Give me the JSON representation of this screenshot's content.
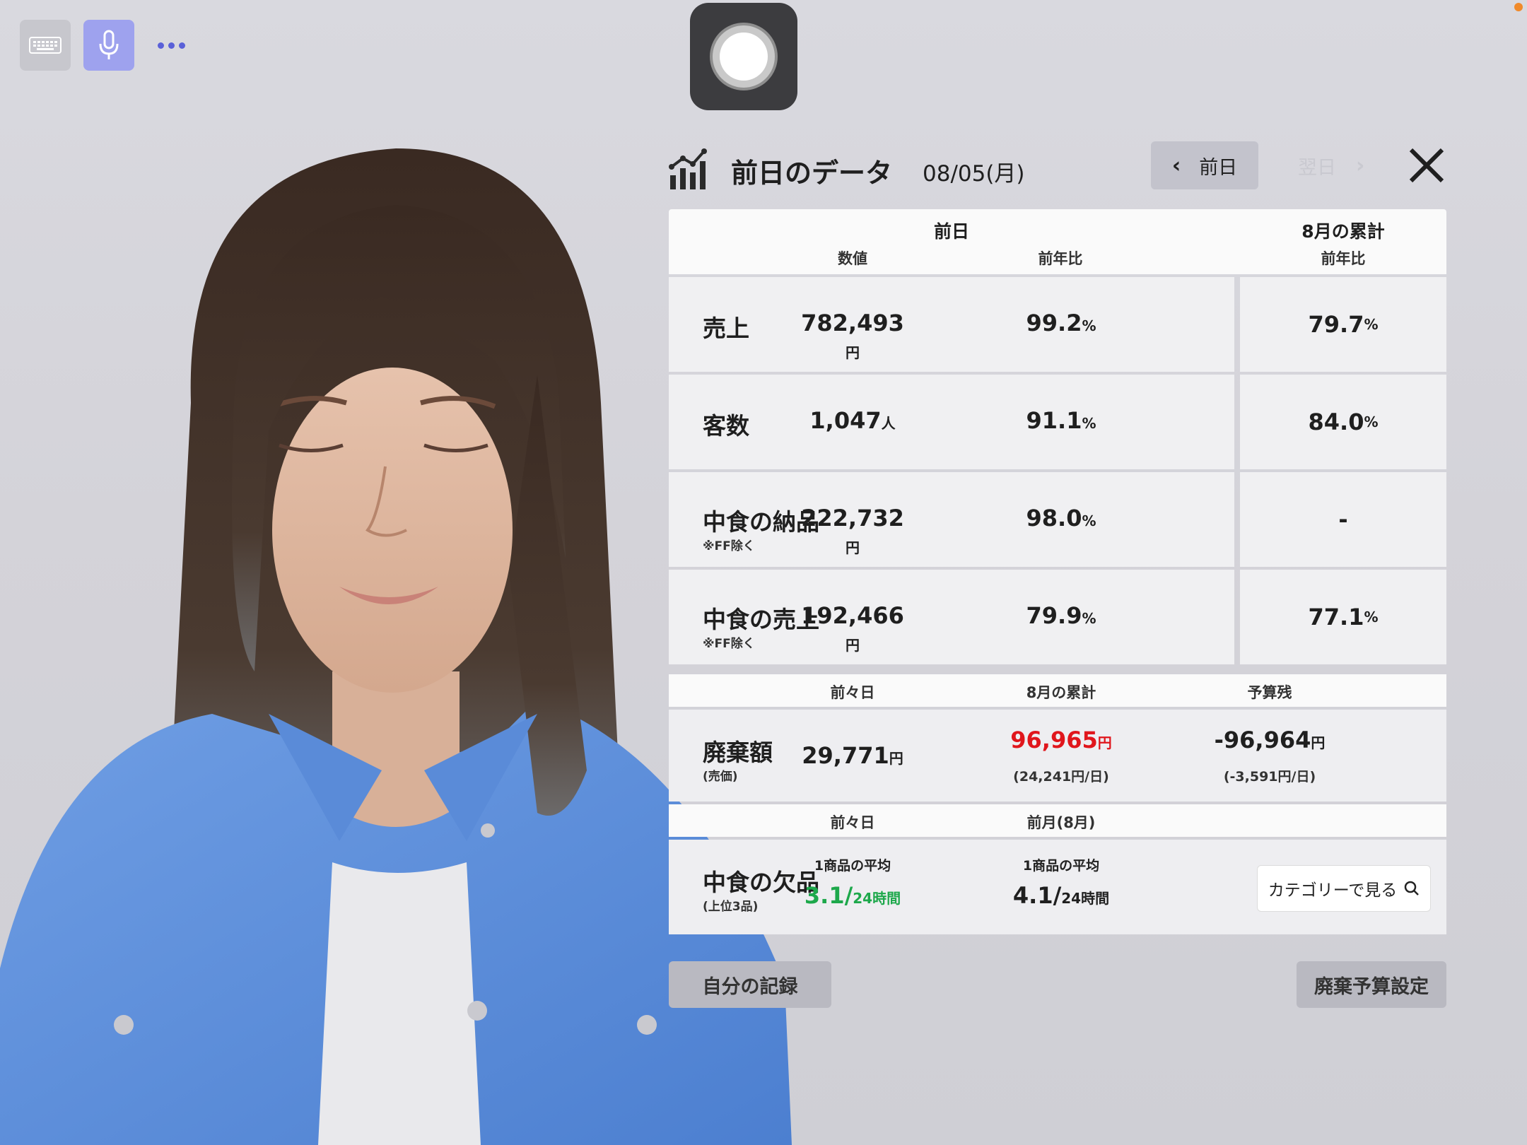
{
  "toolbar": {
    "keyboard_icon": "keyboard-icon",
    "mic_icon": "microphone-icon",
    "more_icon": "more-dots-icon"
  },
  "record_button": {
    "icon": "record-icon"
  },
  "header": {
    "title": "前日のデータ",
    "date": "08/05(月)",
    "prev_label": "前日",
    "next_label": "翌日",
    "close_icon": "close-icon",
    "chart_icon": "chart-icon"
  },
  "table_header": {
    "group_prev": "前日",
    "group_month": "8月の累計",
    "col_value": "数値",
    "col_yoy": "前年比",
    "col_month_yoy": "前年比"
  },
  "rows": [
    {
      "label": "売上",
      "note": "",
      "value": "782,493",
      "unit": "円",
      "yoy": "99.2",
      "month_yoy": "79.7"
    },
    {
      "label": "客数",
      "note": "",
      "value": "1,047",
      "unit": "人",
      "yoy": "91.1",
      "month_yoy": "84.0"
    },
    {
      "label": "中食の納品",
      "note": "※FF除く",
      "value": "222,732",
      "unit": "円",
      "yoy": "98.0",
      "month_yoy": "-"
    },
    {
      "label": "中食の売上",
      "note": "※FF除く",
      "value": "192,466",
      "unit": "円",
      "yoy": "79.9",
      "month_yoy": "77.1"
    }
  ],
  "pct_unit": "%",
  "waste": {
    "hdr_prev2": "前々日",
    "hdr_month": "8月の累計",
    "hdr_budget": "予算残",
    "label": "廃棄額",
    "note": "(売価)",
    "prev2_value": "29,771",
    "month_value": "96,965",
    "month_daily": "(24,241円/日)",
    "budget_value": "-96,964",
    "budget_daily": "(-3,591円/日)",
    "unit": "円"
  },
  "shortage": {
    "hdr_prev2": "前々日",
    "hdr_last_month": "前月(8月)",
    "label": "中食の欠品",
    "note": "(上位3品)",
    "avg_label": "1商品の平均",
    "prev2_value": "3.1/",
    "prev2_unit": "24時間",
    "last_month_value": "4.1/",
    "last_month_unit": "24時間",
    "category_button": "カテゴリーで見る",
    "search_icon": "search-icon"
  },
  "bottom": {
    "my_record": "自分の記録",
    "waste_budget": "廃棄予算設定"
  },
  "colors": {
    "accent": "#9ea2ee",
    "red": "#e0161c",
    "green": "#1da84b"
  }
}
